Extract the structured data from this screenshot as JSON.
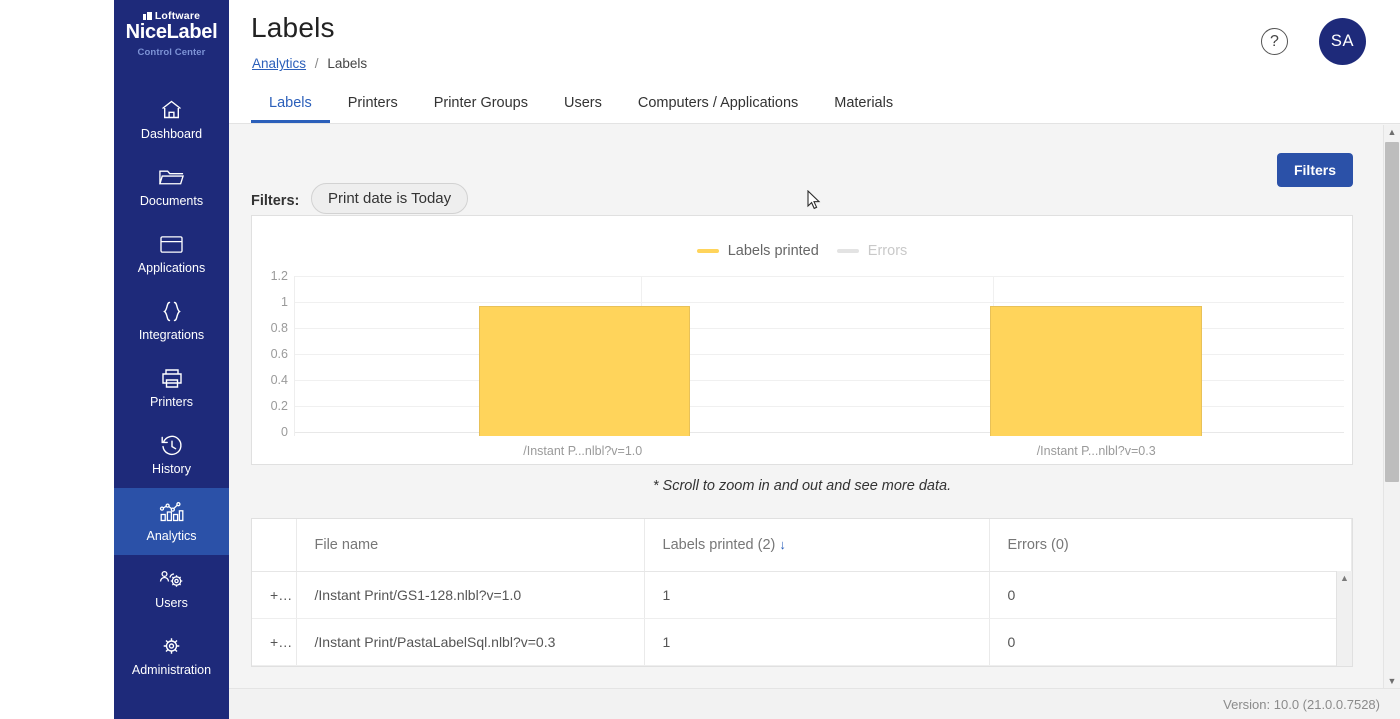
{
  "brand": {
    "company": "Loftware",
    "product": "NiceLabel",
    "subtitle": "Control Center"
  },
  "sidebar": {
    "items": [
      {
        "label": "Dashboard",
        "icon": "home-icon",
        "active": false
      },
      {
        "label": "Documents",
        "icon": "folder-icon",
        "active": false
      },
      {
        "label": "Applications",
        "icon": "window-icon",
        "active": false
      },
      {
        "label": "Integrations",
        "icon": "braces-icon",
        "active": false
      },
      {
        "label": "Printers",
        "icon": "printer-icon",
        "active": false
      },
      {
        "label": "History",
        "icon": "clock-history-icon",
        "active": false
      },
      {
        "label": "Analytics",
        "icon": "bar-chart-icon",
        "active": true
      },
      {
        "label": "Users",
        "icon": "users-gear-icon",
        "active": false
      },
      {
        "label": "Administration",
        "icon": "gear-icon",
        "active": false
      }
    ],
    "active_color": "#2b51a8",
    "background_color": "#1e2a7a"
  },
  "header": {
    "title": "Labels",
    "breadcrumb": {
      "parent": "Analytics",
      "separator": "/",
      "current": "Labels"
    },
    "help_icon": "question-circle-icon",
    "avatar_initials": "SA"
  },
  "tabs": [
    {
      "label": "Labels",
      "active": true
    },
    {
      "label": "Printers",
      "active": false
    },
    {
      "label": "Printer Groups",
      "active": false
    },
    {
      "label": "Users",
      "active": false
    },
    {
      "label": "Computers / Applications",
      "active": false
    },
    {
      "label": "Materials",
      "active": false
    }
  ],
  "filters": {
    "button_label": "Filters",
    "label": "Filters:",
    "chips": [
      "Print date is Today"
    ],
    "accent_color": "#2b51a8"
  },
  "chart_note": "* Scroll to zoom in and out and see more data.",
  "chart_data": {
    "type": "bar",
    "title": "",
    "xlabel": "",
    "ylabel": "",
    "categories": [
      "/Instant P...nlbl?v=1.0",
      "/Instant P...nlbl?v=0.3"
    ],
    "series": [
      {
        "name": "Labels printed",
        "values": [
          1,
          1
        ],
        "color": "#ffd45b",
        "visible": true
      },
      {
        "name": "Errors",
        "values": [
          0,
          0
        ],
        "color": "#e0e0e0",
        "visible": false
      }
    ],
    "ylim": [
      0,
      1.2
    ],
    "yticks": [
      "1.2",
      "1",
      "0.8",
      "0.6",
      "0.4",
      "0.2",
      "0"
    ],
    "ytick_values": [
      1.2,
      1,
      0.8,
      0.6,
      0.4,
      0.2,
      0
    ],
    "grid": true,
    "legend_position": "top-center"
  },
  "table": {
    "columns": [
      {
        "key": "expand",
        "label": ""
      },
      {
        "key": "name",
        "label": "File name"
      },
      {
        "key": "printed",
        "label": "Labels printed (2)",
        "sorted": true,
        "sort_direction": "desc",
        "sort_glyph": "↓"
      },
      {
        "key": "errors",
        "label": "Errors (0)"
      }
    ],
    "rows": [
      {
        "expand": "+",
        "name": "/Instant Print/GS1-128.nlbl?v=1.0",
        "printed": "1",
        "errors": "0"
      },
      {
        "expand": "+",
        "name": "/Instant Print/PastaLabelSql.nlbl?v=0.3",
        "printed": "1",
        "errors": "0"
      }
    ]
  },
  "footer": {
    "version": "Version: 10.0 (21.0.0.7528)"
  }
}
